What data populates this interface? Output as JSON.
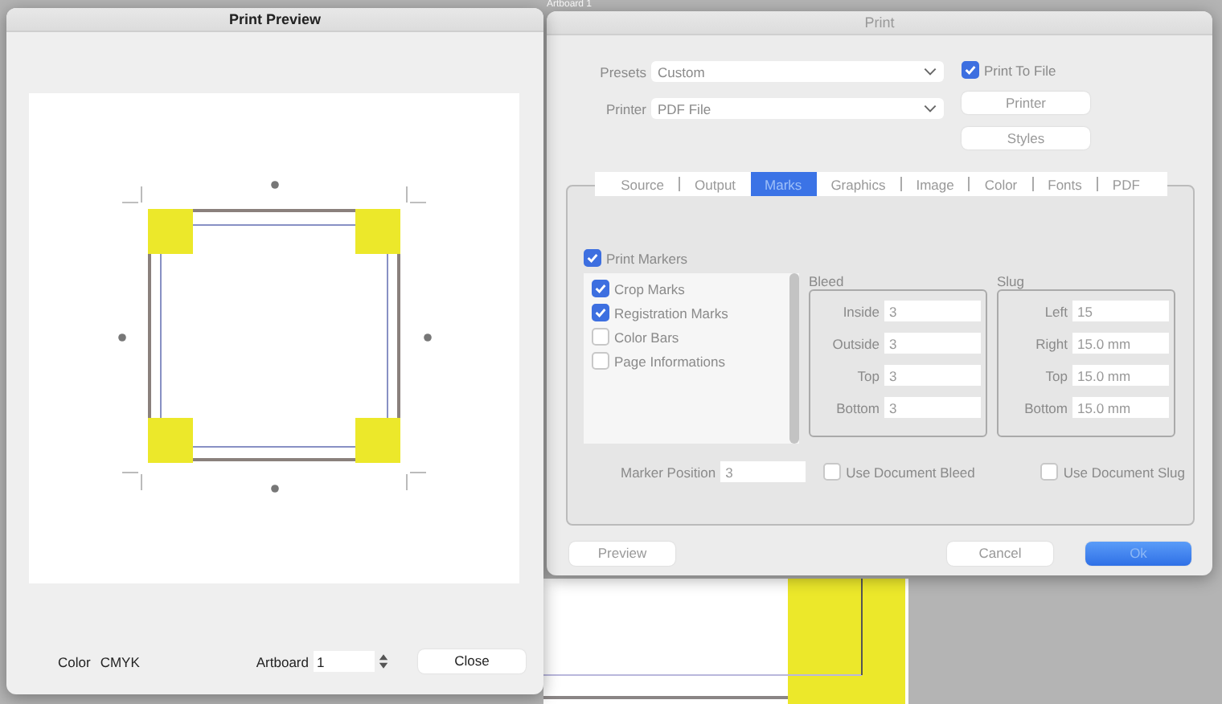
{
  "background": {
    "title": "Artboard 1"
  },
  "preview_window": {
    "title": "Print Preview",
    "color_label": "Color",
    "color_value": "CMYK",
    "artboard_label": "Artboard",
    "artboard_value": "1",
    "close_button": "Close"
  },
  "print_window": {
    "title": "Print",
    "presets": {
      "label": "Presets",
      "value": "Custom"
    },
    "printer": {
      "label": "Printer",
      "value": "PDF File"
    },
    "print_to_file": {
      "label": "Print To File",
      "checked": true
    },
    "side_buttons": [
      "Printer",
      "Styles"
    ],
    "tabs": [
      {
        "label": "Source",
        "selected": false
      },
      {
        "label": "Output",
        "selected": false
      },
      {
        "label": "Marks",
        "selected": true
      },
      {
        "label": "Graphics",
        "selected": false
      },
      {
        "label": "Image",
        "selected": false
      },
      {
        "label": "Color",
        "selected": false
      },
      {
        "label": "Fonts",
        "selected": false
      },
      {
        "label": "PDF",
        "selected": false
      }
    ],
    "print_markers": {
      "label": "Print Markers",
      "checked": true
    },
    "markers": [
      {
        "label": "Crop Marks",
        "checked": true
      },
      {
        "label": "Registration Marks",
        "checked": true
      },
      {
        "label": "Color Bars",
        "checked": false
      },
      {
        "label": "Page Informations",
        "checked": false
      }
    ],
    "bleed": {
      "title": "Bleed",
      "fields": [
        {
          "label": "Inside",
          "value": "3"
        },
        {
          "label": "Outside",
          "value": "3"
        },
        {
          "label": "Top",
          "value": "3"
        },
        {
          "label": "Bottom",
          "value": "3"
        }
      ]
    },
    "slug": {
      "title": "Slug",
      "fields": [
        {
          "label": "Left",
          "value": "15"
        },
        {
          "label": "Right",
          "value": "15.0 mm"
        },
        {
          "label": "Top",
          "value": "15.0 mm"
        },
        {
          "label": "Bottom",
          "value": "15.0 mm"
        }
      ]
    },
    "marker_position": {
      "label": "Marker Position",
      "value": "3"
    },
    "options": [
      {
        "label": "Use Document Bleed",
        "checked": false
      },
      {
        "label": "Use Document Slug",
        "checked": false
      }
    ],
    "buttons": [
      {
        "label": "Preview",
        "kind": "plain"
      },
      {
        "label": "Cancel",
        "kind": "plain"
      },
      {
        "label": "Ok",
        "kind": "default"
      }
    ]
  }
}
